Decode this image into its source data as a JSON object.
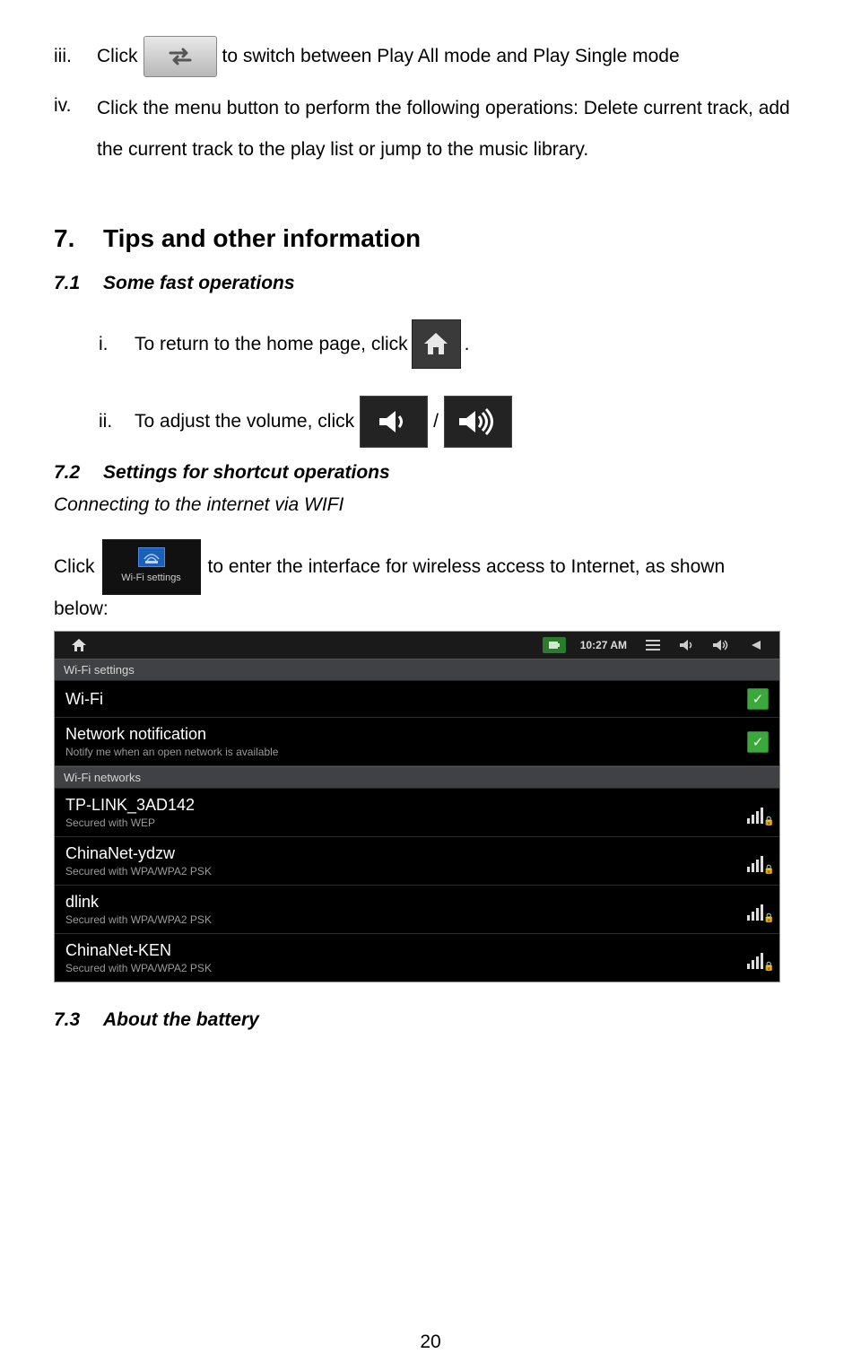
{
  "list1": {
    "item_iii": {
      "numeral": "iii.",
      "label": "Click",
      "text_after": " to switch between Play All mode and Play Single mode"
    },
    "item_iv": {
      "numeral": "iv.",
      "text": "Click the menu button to perform the following operations: Delete current track, add the current track to the play list or jump to the music library."
    }
  },
  "section7": {
    "num": "7.",
    "title": "Tips and other information",
    "sub1": {
      "num": "7.1",
      "title": "Some fast operations"
    },
    "items": {
      "i": {
        "numeral": "i.",
        "text_before": "To return to the home page, click ",
        "text_after": "."
      },
      "ii": {
        "numeral": "ii.",
        "text_before": "To adjust the volume, click ",
        "slash": " / "
      }
    },
    "sub2": {
      "num": "7.2",
      "title": "Settings for shortcut operations"
    },
    "connecting": "Connecting to the internet via WIFI",
    "click_text": "Click ",
    "wifi_label": "Wi-Fi settings",
    "click_after": " to enter the interface for wireless access to Internet, as shown",
    "below": "below:",
    "sub3": {
      "num": "7.3",
      "title": "About the battery"
    }
  },
  "screenshot": {
    "time": "10:27 AM",
    "header1": "Wi-Fi settings",
    "wifi": {
      "title": "Wi-Fi"
    },
    "notif": {
      "title": "Network notification",
      "sub": "Notify me when an open network is available"
    },
    "header2": "Wi-Fi networks",
    "networks": [
      {
        "name": "TP-LINK_3AD142",
        "sub": "Secured with WEP"
      },
      {
        "name": "ChinaNet-ydzw",
        "sub": "Secured with WPA/WPA2 PSK"
      },
      {
        "name": "dlink",
        "sub": "Secured with WPA/WPA2 PSK"
      },
      {
        "name": "ChinaNet-KEN",
        "sub": "Secured with WPA/WPA2 PSK"
      }
    ]
  },
  "page_number": "20"
}
